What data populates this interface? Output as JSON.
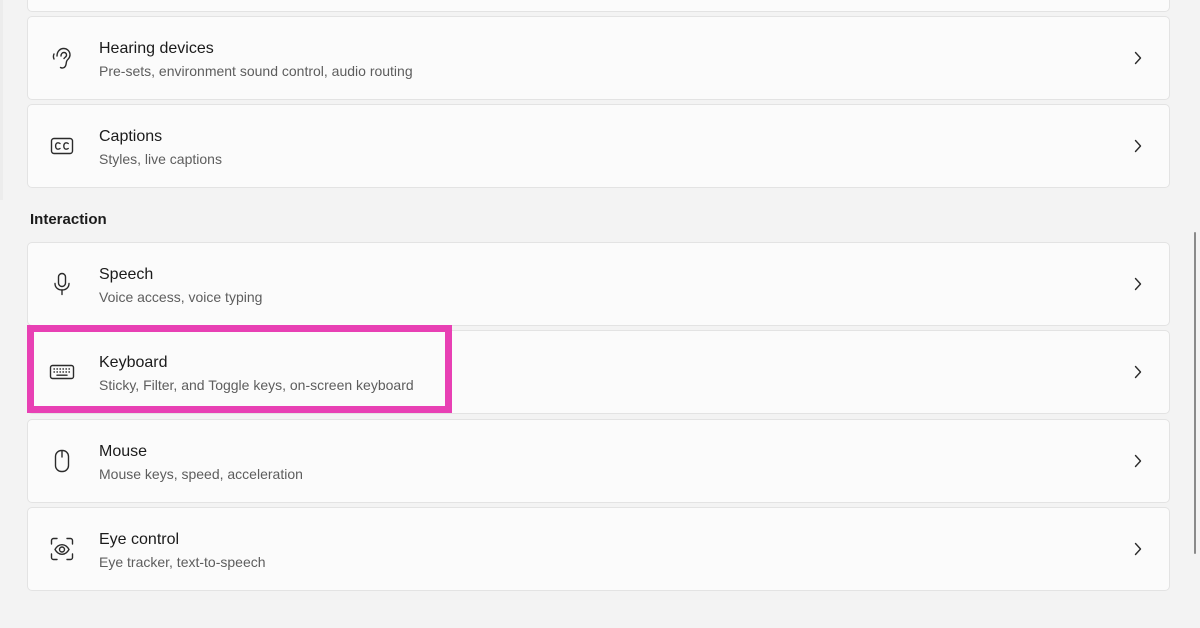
{
  "groups": {
    "interaction_header": "Interaction"
  },
  "items": [
    {
      "key": "hearing",
      "title": "Hearing devices",
      "subtitle": "Pre-sets, environment sound control, audio routing",
      "icon": "hearing-icon"
    },
    {
      "key": "captions",
      "title": "Captions",
      "subtitle": "Styles, live captions",
      "icon": "captions-icon"
    },
    {
      "key": "speech",
      "title": "Speech",
      "subtitle": "Voice access, voice typing",
      "icon": "microphone-icon"
    },
    {
      "key": "keyboard",
      "title": "Keyboard",
      "subtitle": "Sticky, Filter, and Toggle keys, on-screen keyboard",
      "icon": "keyboard-icon"
    },
    {
      "key": "mouse",
      "title": "Mouse",
      "subtitle": "Mouse keys, speed, acceleration",
      "icon": "mouse-icon"
    },
    {
      "key": "eye",
      "title": "Eye control",
      "subtitle": "Eye tracker, text-to-speech",
      "icon": "eye-control-icon"
    }
  ],
  "colors": {
    "highlight": "#e840b4",
    "background": "#f3f3f3",
    "card": "#fbfbfb"
  }
}
